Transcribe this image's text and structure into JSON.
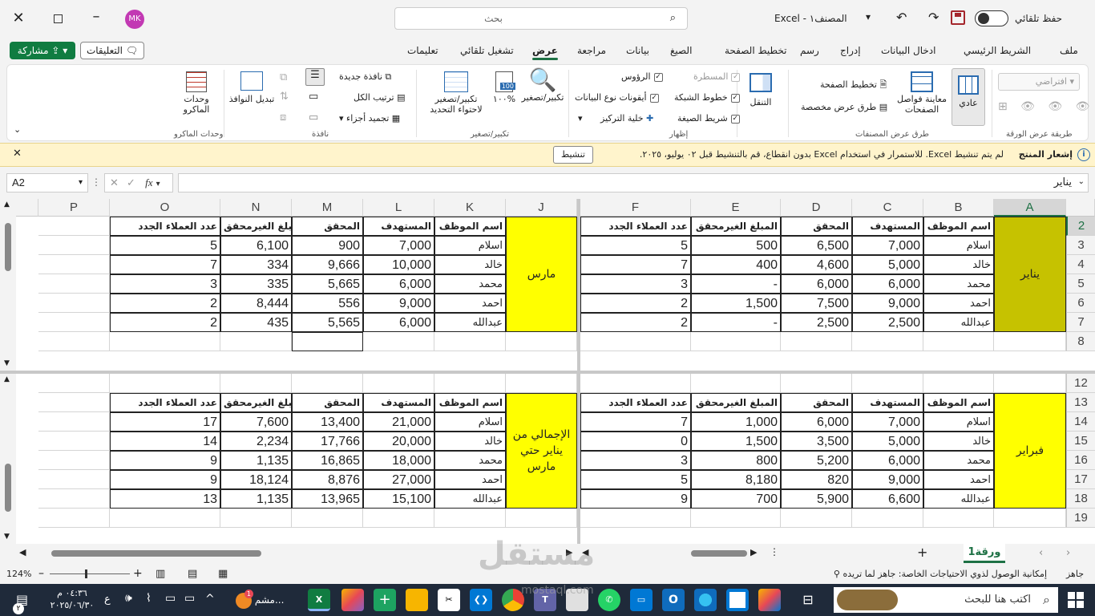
{
  "titlebar": {
    "autosave_label": "حفظ تلقائي",
    "file_name": "المصنف١",
    "app_name": "Excel",
    "separator": "-",
    "search_placeholder": "بحث",
    "user_initials": "MK"
  },
  "menu": {
    "tabs": [
      "ملف",
      "الشريط الرئيسي",
      "ادخال البيانات",
      "إدراج",
      "رسم",
      "تخطيط الصفحة",
      "الصيغ",
      "بيانات",
      "مراجعة",
      "عرض",
      "تشغيل تلقائي",
      "تعليمات"
    ],
    "active_tab": "عرض",
    "comments_label": "التعليقات",
    "share_label": "مشاركة"
  },
  "ribbon": {
    "sheet_view_default": "افتراضي",
    "group_sheet_view": "طريقة عرض الورقة",
    "normal": "عادي",
    "page_break": "معاينة فواصل الصفحات",
    "page_layout": "تخطيط الصفحة",
    "custom_views": "طرق عرض مخصصة",
    "group_workbook_views": "طرق عرض المصنفات",
    "navigation": "التنقل",
    "ruler": "المسطرة",
    "headings": "الرؤوس",
    "gridlines": "خطوط الشبكة",
    "data_type_icons": "أيقونات نوع البيانات",
    "formula_bar": "شريط الصيغة",
    "focus_cell": "خلية التركيز",
    "group_show": "إظهار",
    "zoom": "تكبير/تصغير",
    "zoom100": "١٠٠%",
    "zoom_selection": "تكبير/تصغير لاحتواء التحديد",
    "group_zoom": "تكبير/تصغير",
    "new_window": "نافذة جديدة",
    "arrange_all": "ترتيب الكل",
    "freeze_panes": "تجميد أجزاء",
    "switch_windows": "تبديل النوافذ",
    "group_window": "نافذة",
    "macros": "وحدات الماكرو",
    "group_macros": "وحدات الماكرو"
  },
  "notification": {
    "title": "إشعار المنتج",
    "message": "لم يتم تنشيط Excel. للاستمرار في استخدام Excel بدون انقطاع، قم بالتنشيط قبل ٠٢ يوليو، ٢٠٢٥.",
    "activate_label": "تنشيط"
  },
  "formula_bar": {
    "name_box": "A2",
    "content": "يناير",
    "fx": "fx"
  },
  "columns": [
    "A",
    "B",
    "C",
    "D",
    "E",
    "F",
    "J",
    "K",
    "L",
    "M",
    "N",
    "O",
    "P"
  ],
  "rows_top": [
    "2",
    "3",
    "4",
    "5",
    "6",
    "7",
    "8"
  ],
  "rows_bottom": [
    "12",
    "13",
    "14",
    "15",
    "16",
    "17",
    "18",
    "19"
  ],
  "headers": {
    "name": "اسم الموظف",
    "target": "المستهدف",
    "achieved": "المحقق",
    "remaining": "المبلغ الغيرمحقق",
    "new_clients": "عدد العملاء الجدد"
  },
  "headers_right": {
    "name": "اسم الموظف",
    "target": "المستهدف",
    "achieved": "المحقق",
    "remaining": "المبلغ الغيرمحقق",
    "new_clients": "عدد العملاء الجدد"
  },
  "tables": {
    "january": {
      "label": "يناير",
      "rows": [
        [
          "اسلام",
          "7,000",
          "6,500",
          "500",
          "5"
        ],
        [
          "خالد",
          "5,000",
          "4,600",
          "400",
          "7"
        ],
        [
          "محمد",
          "6,000",
          "6,000",
          "-",
          "3"
        ],
        [
          "احمد",
          "9,000",
          "7,500",
          "1,500",
          "2"
        ],
        [
          "عبدالله",
          "2,500",
          "2,500",
          "-",
          "2"
        ]
      ]
    },
    "march": {
      "label": "مارس",
      "rows": [
        [
          "اسلام",
          "7,000",
          "900",
          "6,100",
          "5"
        ],
        [
          "خالد",
          "10,000",
          "9,666",
          "334",
          "7"
        ],
        [
          "محمد",
          "6,000",
          "5,665",
          "335",
          "3"
        ],
        [
          "احمد",
          "9,000",
          "556",
          "8,444",
          "2"
        ],
        [
          "عبدالله",
          "6,000",
          "5,565",
          "435",
          "2"
        ]
      ]
    },
    "february": {
      "label": "فبراير",
      "rows": [
        [
          "اسلام",
          "7,000",
          "6,000",
          "1,000",
          "7"
        ],
        [
          "خالد",
          "5,000",
          "3,500",
          "1,500",
          "0"
        ],
        [
          "محمد",
          "6,000",
          "5,200",
          "800",
          "3"
        ],
        [
          "احمد",
          "9,000",
          "820",
          "8,180",
          "5"
        ],
        [
          "عبدالله",
          "6,600",
          "5,900",
          "700",
          "9"
        ]
      ]
    },
    "total": {
      "label": "الإجمالي من يناير حتي مارس",
      "rows": [
        [
          "اسلام",
          "21,000",
          "13,400",
          "7,600",
          "17"
        ],
        [
          "خالد",
          "20,000",
          "17,766",
          "2,234",
          "14"
        ],
        [
          "محمد",
          "18,000",
          "16,865",
          "1,135",
          "9"
        ],
        [
          "احمد",
          "27,000",
          "8,876",
          "18,124",
          "9"
        ],
        [
          "عبدالله",
          "15,100",
          "13,965",
          "1,135",
          "13"
        ]
      ]
    }
  },
  "sheet_tab": "ورقة1",
  "status": {
    "ready": "جاهز",
    "accessibility": "إمكانية الوصول لذوي الاحتياجات الخاصة: جاهز لما تريده",
    "zoom": "124%"
  },
  "taskbar": {
    "search_placeholder": "اكتب هنا للبحث",
    "time": "٠٤:٣٦ م",
    "date": "٢٠٢٥/٠٦/٣٠",
    "lang": "ع",
    "app_label": "مشم...",
    "notif_count": "٢"
  },
  "watermark": {
    "text": "مستقل",
    "url": "mostaql.com"
  },
  "colors": {
    "accent": "#1e7145",
    "olive": "#c6c200",
    "yellow": "#ffff00",
    "share_green": "#107c41"
  }
}
